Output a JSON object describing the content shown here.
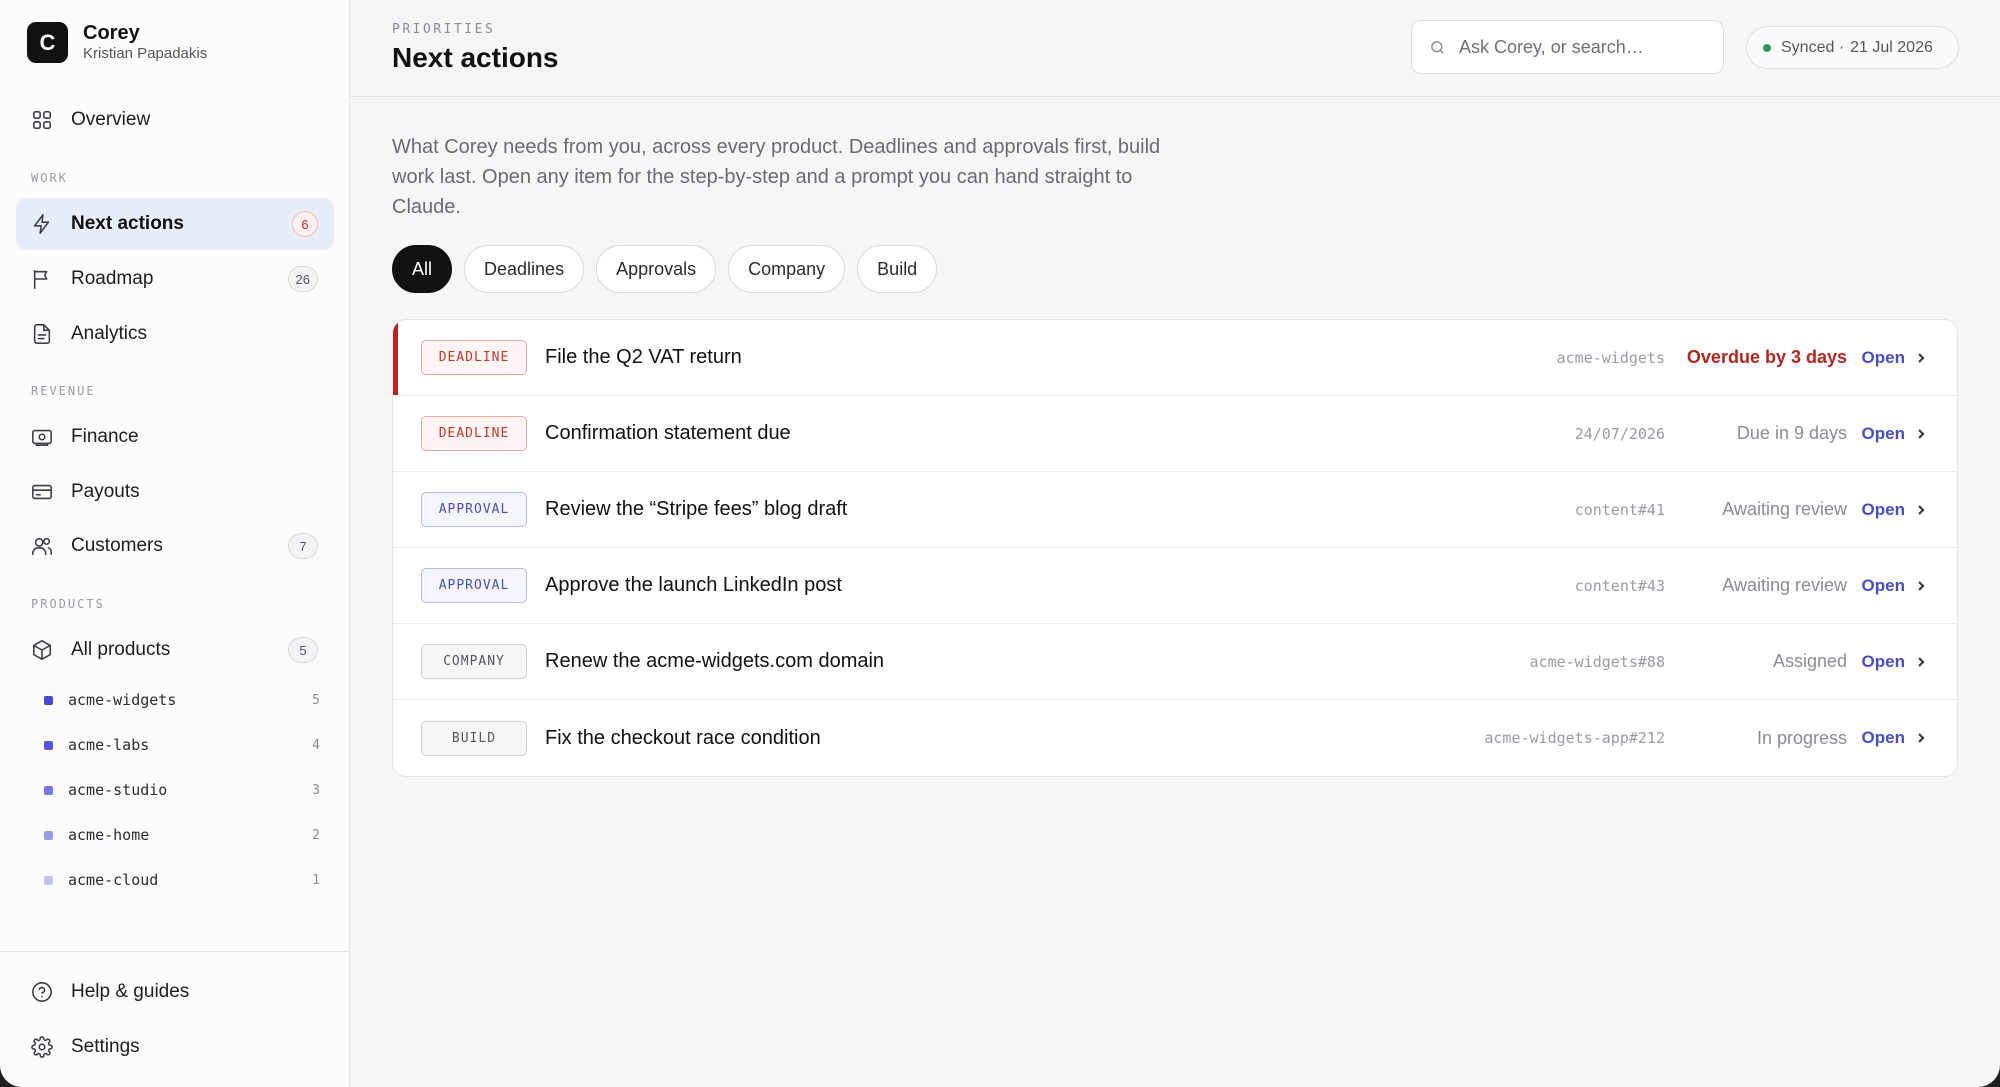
{
  "brand": {
    "logo_letter": "C",
    "name": "Corey",
    "user": "Kristian Papadakis"
  },
  "sidebar": {
    "overview": {
      "label": "Overview",
      "icon": "grid-icon"
    },
    "work_label": "WORK",
    "work_items": [
      {
        "label": "Next actions",
        "icon": "bolt-icon",
        "badge": "6",
        "active": true
      },
      {
        "label": "Roadmap",
        "icon": "flag-icon",
        "badge": "26"
      },
      {
        "label": "Analytics",
        "icon": "document-icon"
      }
    ],
    "revenue_label": "REVENUE",
    "revenue_items": [
      {
        "label": "Finance",
        "icon": "banknote-icon"
      },
      {
        "label": "Payouts",
        "icon": "card-icon"
      },
      {
        "label": "Customers",
        "icon": "users-icon",
        "badge": "7"
      }
    ],
    "products_label": "PRODUCTS",
    "all_products": {
      "label": "All products",
      "icon": "box-icon",
      "badge": "5"
    },
    "products": [
      {
        "name": "acme-widgets",
        "count": "5",
        "color": "#4b47d6"
      },
      {
        "name": "acme-labs",
        "count": "4",
        "color": "#5a55dc"
      },
      {
        "name": "acme-studio",
        "count": "3",
        "color": "#7b78e3"
      },
      {
        "name": "acme-home",
        "count": "2",
        "color": "#9d9aea"
      },
      {
        "name": "acme-cloud",
        "count": "1",
        "color": "#c4c2f2"
      }
    ],
    "footer": [
      {
        "label": "Help & guides",
        "icon": "help-icon"
      },
      {
        "label": "Settings",
        "icon": "gear-icon"
      }
    ]
  },
  "header": {
    "eyebrow": "PRIORITIES",
    "title": "Next actions",
    "search_placeholder": "Ask Corey, or search…",
    "sync_status": "Synced ·",
    "sync_date": "21 Jul 2026"
  },
  "intro": "What Corey needs from you, across every product. Deadlines and approvals first, build work last. Open any item for the step-by-step and a prompt you can hand straight to Claude.",
  "filters": [
    "All",
    "Deadlines",
    "Approvals",
    "Company",
    "Build"
  ],
  "active_filter": "All",
  "actions": [
    {
      "tag": "DEADLINE",
      "type": "deadline",
      "title": "File the Q2 VAT return",
      "ref": "acme-widgets",
      "status": "Overdue by 3 days",
      "overdue": true,
      "open": "Open"
    },
    {
      "tag": "DEADLINE",
      "type": "deadline",
      "title": "Confirmation statement due",
      "ref": "24/07/2026",
      "status": "Due in 9 days",
      "open": "Open"
    },
    {
      "tag": "APPROVAL",
      "type": "approval",
      "title": "Review the “Stripe fees” blog draft",
      "ref": "content#41",
      "status": "Awaiting review",
      "open": "Open"
    },
    {
      "tag": "APPROVAL",
      "type": "approval",
      "title": "Approve the launch LinkedIn post",
      "ref": "content#43",
      "status": "Awaiting review",
      "open": "Open"
    },
    {
      "tag": "COMPANY",
      "type": "company",
      "title": "Renew the acme-widgets.com domain",
      "ref": "acme-widgets#88",
      "status": "Assigned",
      "open": "Open"
    },
    {
      "tag": "BUILD",
      "type": "build",
      "title": "Fix the checkout race condition",
      "ref": "acme-widgets-app#212",
      "status": "In progress",
      "open": "Open"
    }
  ],
  "colors": {
    "accent": "#4a4fc0",
    "danger": "#b3261e",
    "active_nav_bg": "#e8edfa",
    "sync_dot": "#2e9d52"
  }
}
